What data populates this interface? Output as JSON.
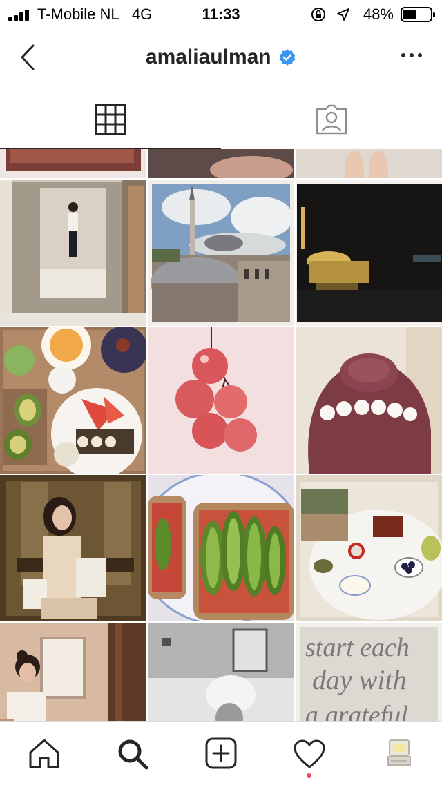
{
  "status_bar": {
    "carrier": "T-Mobile NL",
    "network": "4G",
    "time": "11:33",
    "battery_percent": "48%",
    "battery_level": 0.48,
    "icons": [
      "signal-icon",
      "orientation-lock-icon",
      "location-arrow-icon",
      "battery-icon"
    ]
  },
  "header": {
    "username": "amaliaulman",
    "verified": true,
    "back_icon": "chevron-left-icon",
    "more_icon": "more-horizontal-icon"
  },
  "profile_tabs": [
    {
      "icon": "grid-icon",
      "active": true
    },
    {
      "icon": "tagged-person-icon",
      "active": false
    }
  ],
  "posts": [
    {
      "subject": "partially visible photo"
    },
    {
      "subject": "partially visible photo"
    },
    {
      "subject": "partially visible photo of feet"
    },
    {
      "subject": "mirror selfie in hallway"
    },
    {
      "subject": "mosque dome under blue sky"
    },
    {
      "subject": "mosque lit at night"
    },
    {
      "subject": "breakfast table with avocado and watermelon"
    },
    {
      "subject": "red grapes close-up"
    },
    {
      "subject": "hair bun with white flowers"
    },
    {
      "subject": "selfie in elevator mirrors"
    },
    {
      "subject": "avocado toast"
    },
    {
      "subject": "breakfast table with figs and blueberries"
    },
    {
      "subject": "woman by hotel window"
    },
    {
      "subject": "black and white photo of woman in bed with towel"
    },
    {
      "subject": "handwritten quote"
    }
  ],
  "quote_post": {
    "lines": [
      "start each",
      "day with",
      "a grateful"
    ]
  },
  "tab_bar": [
    {
      "icon": "home-icon"
    },
    {
      "icon": "search-icon",
      "active": true
    },
    {
      "icon": "add-post-icon"
    },
    {
      "icon": "heart-icon",
      "notification_dot": true
    },
    {
      "icon": "profile-avatar-icon"
    }
  ],
  "colors": {
    "verified_blue": "#3897f0",
    "notification_red": "#ed4956",
    "icon_dark": "#262626",
    "divider": "#dbdbdb"
  }
}
